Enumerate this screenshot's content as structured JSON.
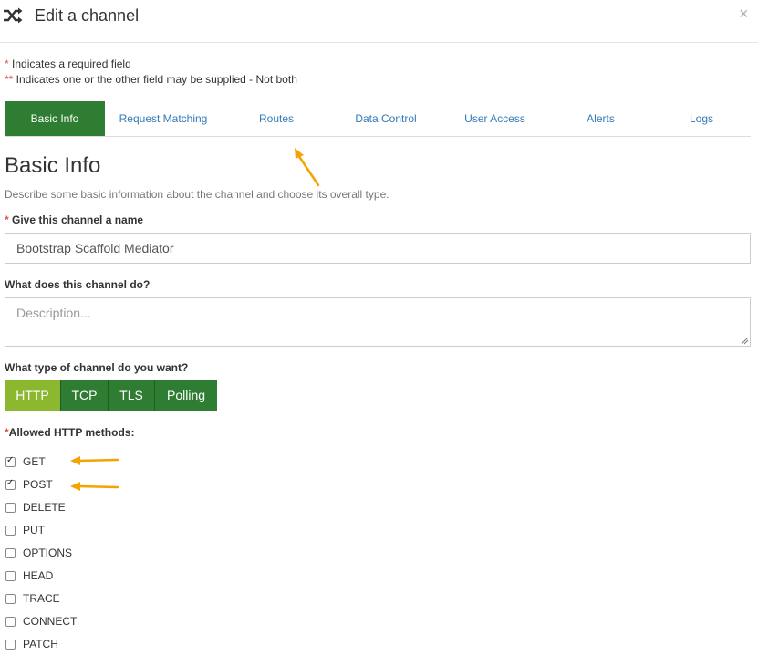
{
  "header": {
    "title": "Edit a channel",
    "close": "×",
    "icon": "shuffle-icon"
  },
  "notes": {
    "required_marker": "*",
    "required_text": " Indicates a required field",
    "either_marker": "**",
    "either_text": " Indicates one or the other field may be supplied - Not both"
  },
  "tabs": [
    {
      "label": "Basic Info",
      "active": true
    },
    {
      "label": "Request Matching"
    },
    {
      "label": "Routes"
    },
    {
      "label": "Data Control"
    },
    {
      "label": "User Access"
    },
    {
      "label": "Alerts"
    },
    {
      "label": "Logs"
    }
  ],
  "section": {
    "title": "Basic Info",
    "description": "Describe some basic information about the channel and choose its overall type."
  },
  "name_field": {
    "marker": "*",
    "label": " Give this channel a name",
    "value": "Bootstrap Scaffold Mediator"
  },
  "desc_field": {
    "label": "What does this channel do?",
    "placeholder": "Description..."
  },
  "type_field": {
    "label": "What type of channel do you want?",
    "options": [
      "HTTP",
      "TCP",
      "TLS",
      "Polling"
    ],
    "selected": "HTTP"
  },
  "methods": {
    "marker": "*",
    "label": "Allowed HTTP methods:",
    "items": [
      {
        "label": "GET",
        "checked": true
      },
      {
        "label": "POST",
        "checked": true
      },
      {
        "label": "DELETE",
        "checked": false
      },
      {
        "label": "PUT",
        "checked": false
      },
      {
        "label": "OPTIONS",
        "checked": false
      },
      {
        "label": "HEAD",
        "checked": false
      },
      {
        "label": "TRACE",
        "checked": false
      },
      {
        "label": "CONNECT",
        "checked": false
      },
      {
        "label": "PATCH",
        "checked": false
      }
    ]
  },
  "colors": {
    "accent_green": "#2e7d32",
    "selected_green": "#8bb82f",
    "link_blue": "#337ab7",
    "annotation_orange": "#f5a300"
  }
}
